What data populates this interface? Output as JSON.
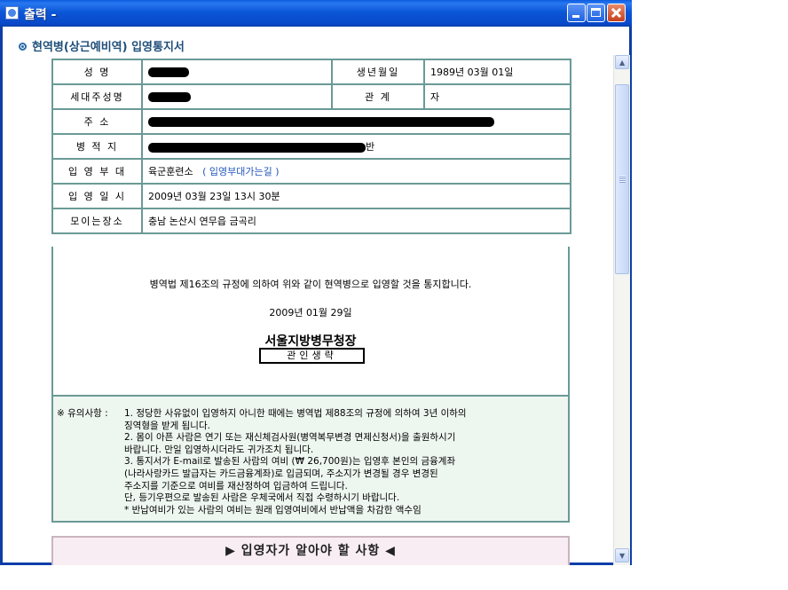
{
  "window": {
    "title": "출력 -",
    "buttons": {
      "minimize": "minimize",
      "maximize": "maximize",
      "close": "close"
    }
  },
  "section_title": "현역병(상근예비역) 입영통지서",
  "form": {
    "name_label": "성 명",
    "birth_label": "생년월일",
    "birth_value": "1989년 03월 01일",
    "householder_label": "세대주성명",
    "relation_label": "관 계",
    "relation_value": "자",
    "address_label": "주 소",
    "registry_label": "병 적 지",
    "registry_suffix": "반",
    "unit_label": "입 영 부 대",
    "unit_value": "육군훈련소",
    "unit_link": "( 입영부대가는길 )",
    "date_label": "입 영 일 시",
    "date_value": "2009년 03월 23일 13시 30분",
    "meeting_label": "모이는장소",
    "meeting_value": "충남 논산시 연무읍 금곡리"
  },
  "notice": {
    "text": "병역법 제16조의 규정에 의하여 위와 같이 현역병으로 입영할 것을 통지합니다.",
    "date": "2009년 01월 29일",
    "issuer": "서울지방병무청장",
    "seal": "관인생략"
  },
  "caution": {
    "head": "※ 유의사항 :",
    "lines": [
      "1. 정당한 사유없이 입영하지 아니한 때에는 병역법 제88조의 규정에 의하여 3년 이하의",
      "    징역형을 받게 됩니다.",
      "2. 몸이 아픈 사람은 연기 또는 재신체검사원(병역복무변경 면제신청서)을 출원하시기",
      "    바랍니다. 만일 입영하시더라도 귀가조치 됩니다.",
      "3. 통지서가 E-mail로 발송된 사람의 여비 (₩ 26,700원)는 입영후 본인의 금융계좌",
      "    (나라사랑카드 발급자는 카드금융계좌)로 입금되며, 주소지가 변경될 경우 변경된",
      "    주소지를 기준으로 여비를 재산정하여 입금하여 드립니다.",
      "    단, 등기우편으로 발송된 사람은 우체국에서 직접 수령하시기 바랍니다.",
      " *  반납여비가 있는 사람의 여비는 원래 입영여비에서 반납액을 차감한 액수임"
    ]
  },
  "guide_bar": "▶ 입영자가 알아야 할 사항 ◀",
  "colors": {
    "title_bar": "#0b57d8",
    "table_border": "#6a9a96",
    "caution_bg": "#eef6f0",
    "guide_bg": "#f8edf3",
    "link": "#2255bb"
  }
}
